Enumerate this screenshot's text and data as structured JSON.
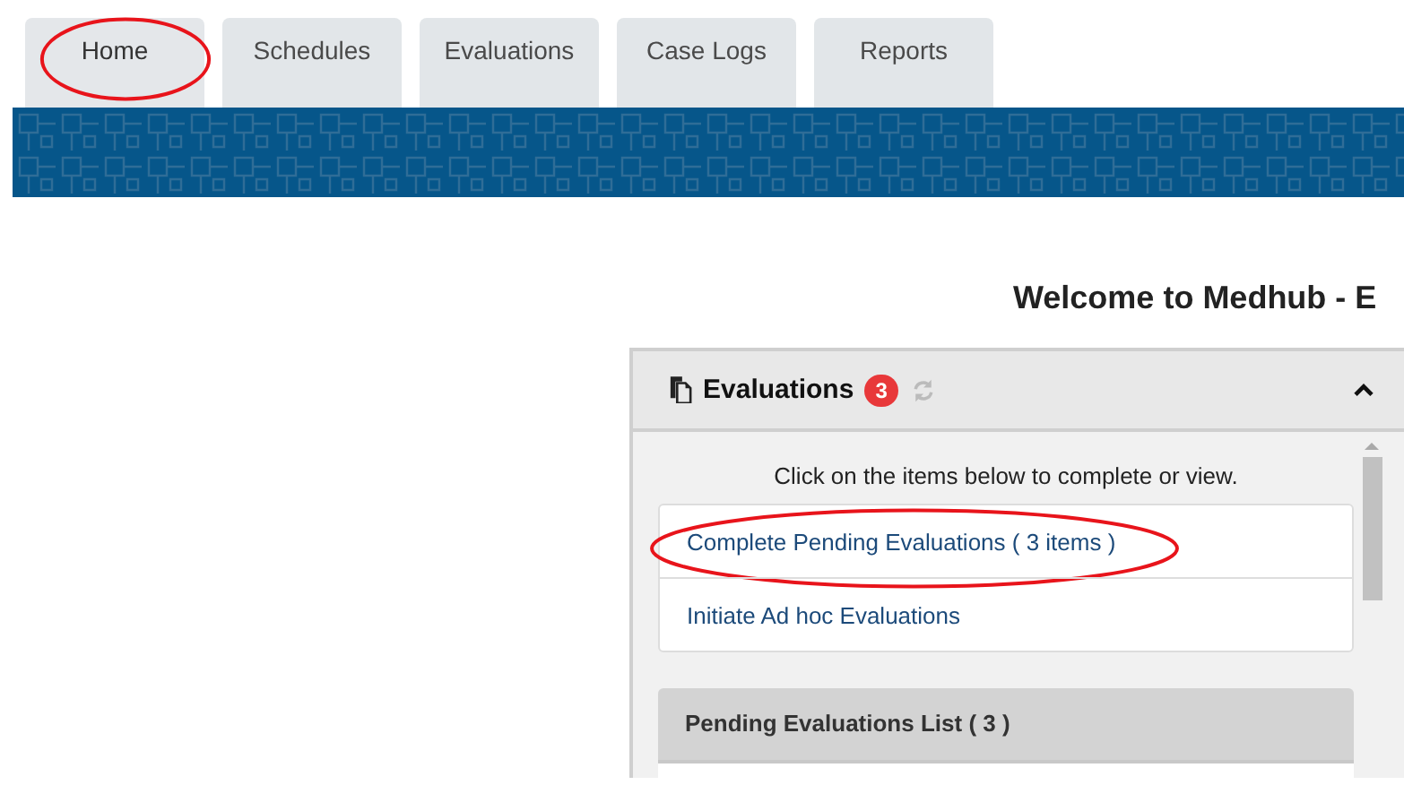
{
  "tabs": [
    {
      "label": "Home",
      "selected": true,
      "circled": true
    },
    {
      "label": "Schedules",
      "selected": false,
      "circled": false
    },
    {
      "label": "Evaluations",
      "selected": false,
      "circled": false
    },
    {
      "label": "Case Logs",
      "selected": false,
      "circled": false
    },
    {
      "label": "Reports",
      "selected": false,
      "circled": false
    }
  ],
  "page_title": "Welcome to Medhub - E",
  "panel": {
    "title": "Evaluations",
    "badge": "3",
    "expanded": true,
    "intro": "Click on the items below to complete or view.",
    "links": [
      {
        "label": "Complete Pending Evaluations ( 3 items )",
        "circled": true
      },
      {
        "label": "Initiate Ad hoc Evaluations",
        "circled": false
      }
    ],
    "section_title": "Pending Evaluations List ( 3 )"
  }
}
